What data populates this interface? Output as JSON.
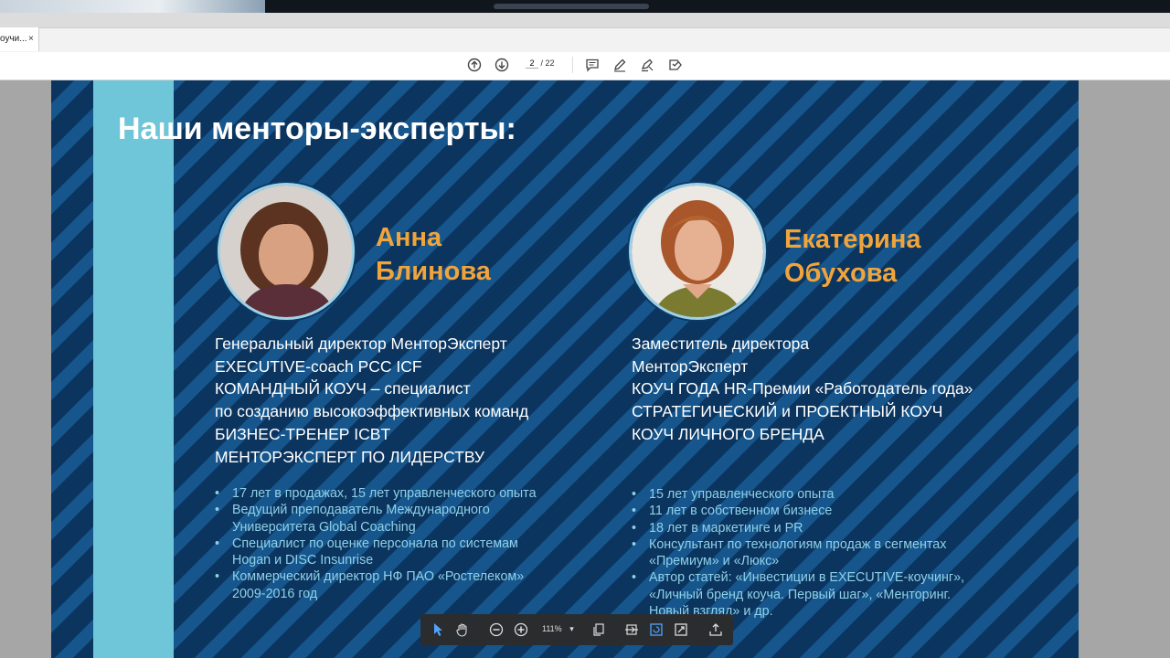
{
  "browser": {
    "tab_label": "оучи...",
    "tab_close": "×"
  },
  "pdf_toolbar": {
    "current_page": "2",
    "page_separator": "/",
    "total_pages": "22"
  },
  "slide": {
    "title": "Наши менторы-эксперты:",
    "mentors": [
      {
        "name_line1": "Анна",
        "name_line2": "Блинова",
        "roles": [
          "Генеральный директор МенторЭксперт",
          "EXECUTIVE-coach PCC ICF",
          "КОМАНДНЫЙ КОУЧ – специалист",
          "по созданию высокоэффективных команд",
          "БИЗНЕС-ТРЕНЕР ICBT",
          "МЕНТОРЭКСПЕРТ ПО ЛИДЕРСТВУ"
        ],
        "bullets": [
          [
            "17 лет в продажах, 15 лет управленческого опыта"
          ],
          [
            "Ведущий преподаватель Международного",
            "Университета Global Coaching"
          ],
          [
            "Специалист по оценке персонала по системам",
            "Hogan и DISC Insunrise"
          ],
          [
            "Коммерческий директор НФ ПАО «Ростелеком»",
            "2009-2016 год"
          ]
        ]
      },
      {
        "name_line1": "Екатерина",
        "name_line2": "Обухова",
        "roles": [
          "Заместитель директора",
          "МенторЭксперт",
          "КОУЧ ГОДА HR-Премии «Работодатель года»",
          "СТРАТЕГИЧЕСКИЙ и ПРОЕКТНЫЙ КОУЧ",
          "КОУЧ ЛИЧНОГО БРЕНДА"
        ],
        "bullets": [
          [
            "15 лет управленческого опыта"
          ],
          [
            "11 лет в собственном бизнесе"
          ],
          [
            "18 лет в маркетинге и PR"
          ],
          [
            "Консультант по технологиям продаж в сегментах",
            "«Премиум» и «Люкс»"
          ],
          [
            "Автор статей: «Инвестиции в EXECUTIVE-коучинг»,",
            "«Личный бренд коуча. Первый шаг», «Менторинг.",
            "Новый взгляд» и др."
          ]
        ]
      }
    ]
  },
  "floating_toolbar": {
    "zoom": "111%",
    "zoom_dropdown": "▾"
  },
  "colors": {
    "slide_background": "#0d3d6e",
    "accent_bar": "#6fc6d8",
    "name_color": "#f0a43c",
    "bullet_color": "#8fd0e8"
  },
  "icons": [
    "arrow-up-icon",
    "arrow-down-icon",
    "comment-icon",
    "pen-icon",
    "highlight-icon",
    "stamp-icon",
    "cursor-icon",
    "hand-icon",
    "zoom-out-icon",
    "zoom-in-icon",
    "copy-icon",
    "fit-page-icon",
    "rotate-icon",
    "fullscreen-icon",
    "share-icon"
  ]
}
